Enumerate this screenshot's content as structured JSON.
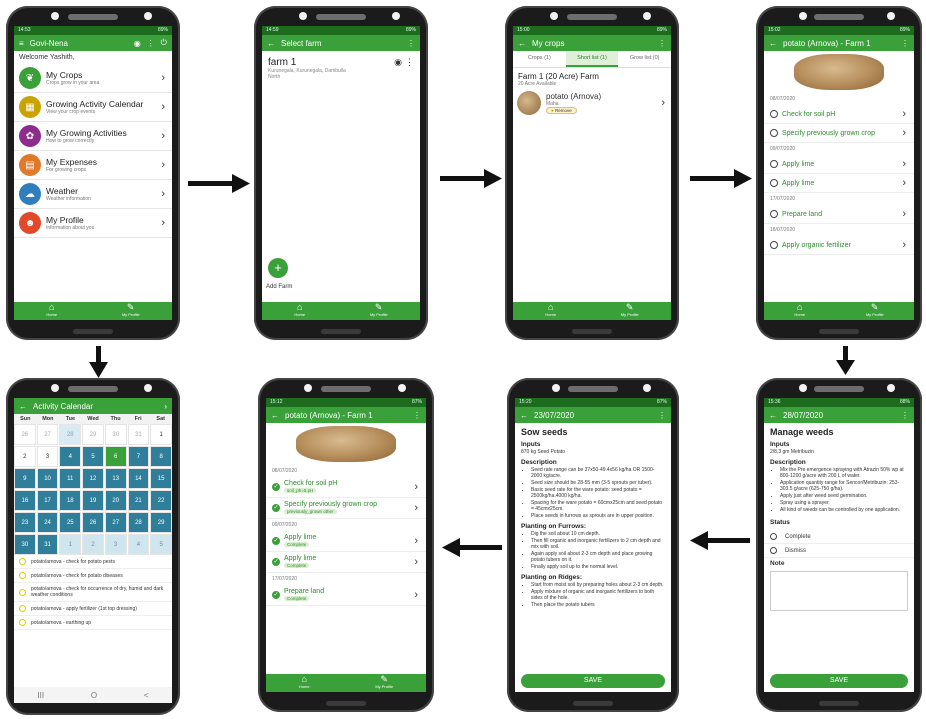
{
  "phone1": {
    "status": {
      "time": "14:53",
      "right": "89%"
    },
    "title": "Govi-Nena",
    "welcome": "Welcome Yashith,",
    "items": [
      {
        "title": "My Crops",
        "sub": "Crops grow in your area",
        "icon": "leaf-icon",
        "color": "#3aa03a",
        "glyph": "❦"
      },
      {
        "title": "Growing Activity Calendar",
        "sub": "View your crop events",
        "icon": "calendar-icon",
        "color": "#c9a300",
        "glyph": "▦"
      },
      {
        "title": "My Growing Activities",
        "sub": "How to grow correctly",
        "icon": "activities-icon",
        "color": "#8e2c8e",
        "glyph": "✿"
      },
      {
        "title": "My Expenses",
        "sub": "For growing crops",
        "icon": "expenses-icon",
        "color": "#e07a2a",
        "glyph": "▤"
      },
      {
        "title": "Weather",
        "sub": "Weather information",
        "icon": "weather-icon",
        "color": "#2f7fbf",
        "glyph": "☁"
      },
      {
        "title": "My Profile",
        "sub": "Information about you",
        "icon": "profile-icon",
        "color": "#e04a2a",
        "glyph": "☻"
      }
    ],
    "nav": [
      "Home",
      "My Profile"
    ]
  },
  "phone2": {
    "status": {
      "time": "14:59",
      "right": "89%"
    },
    "title": "Select farm",
    "farm_name": "farm 1",
    "farm_addr": "Kurunegala, Kurunegala, Dambulla\nNorth",
    "add_label": "Add Farm",
    "nav": [
      "Home",
      "My Profile"
    ]
  },
  "phone3": {
    "status": {
      "time": "15:00",
      "right": "89%"
    },
    "title": "My crops",
    "tabs": [
      "Crops (1)",
      "Short list (1)",
      "Grow list (0)"
    ],
    "farm": "Farm 1 (20 Acre) Farm",
    "avail": "20 Acre Available",
    "crop": "potato (Arnova)",
    "season": "Maha",
    "badge": "Remove",
    "nav": [
      "Home",
      "My Profile"
    ]
  },
  "phone4": {
    "status": {
      "time": "15:02",
      "right": "89%"
    },
    "title": "potato (Arnova) - Farm 1",
    "entries": [
      {
        "date": "08/07/2020",
        "tasks": [
          "Check for soil pH",
          "Specify previously grown crop"
        ]
      },
      {
        "date": "09/07/2020",
        "tasks": [
          "Apply lime",
          "Apply lime"
        ]
      },
      {
        "date": "17/07/2020",
        "tasks": [
          "Prepare land"
        ]
      },
      {
        "date": "18/07/2020",
        "tasks": [
          "Apply organic fertilizer"
        ]
      }
    ],
    "nav": [
      "Home",
      "My Profile"
    ]
  },
  "phone5": {
    "title": "Activity Calendar",
    "days": [
      "Sun",
      "Mon",
      "Tue",
      "Wed",
      "Thu",
      "Fri",
      "Sat"
    ],
    "cells": [
      {
        "v": "26",
        "c": "muted"
      },
      {
        "v": "27",
        "c": "muted"
      },
      {
        "v": "28",
        "c": "today"
      },
      {
        "v": "29",
        "c": "muted"
      },
      {
        "v": "30",
        "c": "muted"
      },
      {
        "v": "31",
        "c": "muted"
      },
      {
        "v": "1",
        "c": ""
      },
      {
        "v": "2",
        "c": ""
      },
      {
        "v": "3",
        "c": ""
      },
      {
        "v": "4",
        "c": "blue"
      },
      {
        "v": "5",
        "c": "blue"
      },
      {
        "v": "6",
        "c": "green"
      },
      {
        "v": "7",
        "c": "blue"
      },
      {
        "v": "8",
        "c": "blue"
      },
      {
        "v": "9",
        "c": "blue"
      },
      {
        "v": "10",
        "c": "blue"
      },
      {
        "v": "11",
        "c": "blue"
      },
      {
        "v": "12",
        "c": "blue"
      },
      {
        "v": "13",
        "c": "blue"
      },
      {
        "v": "14",
        "c": "blue"
      },
      {
        "v": "15",
        "c": "blue"
      },
      {
        "v": "16",
        "c": "blue"
      },
      {
        "v": "17",
        "c": "blue"
      },
      {
        "v": "18",
        "c": "blue"
      },
      {
        "v": "19",
        "c": "blue"
      },
      {
        "v": "20",
        "c": "blue"
      },
      {
        "v": "21",
        "c": "blue"
      },
      {
        "v": "22",
        "c": "blue"
      },
      {
        "v": "23",
        "c": "blue"
      },
      {
        "v": "24",
        "c": "blue"
      },
      {
        "v": "25",
        "c": "blue"
      },
      {
        "v": "26",
        "c": "blue"
      },
      {
        "v": "27",
        "c": "blue"
      },
      {
        "v": "28",
        "c": "blue"
      },
      {
        "v": "29",
        "c": "blue"
      },
      {
        "v": "30",
        "c": "blue"
      },
      {
        "v": "31",
        "c": "blue"
      },
      {
        "v": "1",
        "c": "light"
      },
      {
        "v": "2",
        "c": "light"
      },
      {
        "v": "3",
        "c": "light"
      },
      {
        "v": "4",
        "c": "light"
      },
      {
        "v": "5",
        "c": "light"
      }
    ],
    "events": [
      "potato/arnova - check for potato pests",
      "potato/arnova - check for potato diseases",
      "potato/arnova - check for occurrence of dry, humid and dark weather conditions",
      "potato/arnova - apply fertilizer (1st top dressing)",
      "potato/arnova - earthing up"
    ],
    "sysnav": [
      "III",
      "O",
      "<"
    ]
  },
  "phone6": {
    "status": {
      "time": "15:12",
      "right": "87%"
    },
    "title": "potato (Arnova) - Farm 1",
    "entries": [
      {
        "date": "08/07/2020",
        "tasks": [
          {
            "t": "Check for soil pH",
            "b": "soil_ph=5.pH"
          },
          {
            "t": "Specify previously grown crop",
            "b": "previously_grown other"
          }
        ]
      },
      {
        "date": "09/07/2020",
        "tasks": [
          {
            "t": "Apply lime",
            "b": "Complete"
          },
          {
            "t": "Apply lime",
            "b": "Complete"
          }
        ]
      },
      {
        "date": "17/07/2020",
        "tasks": [
          {
            "t": "Prepare land",
            "b": "Complete"
          }
        ]
      }
    ],
    "nav": [
      "Home",
      "My Profile"
    ]
  },
  "phone7": {
    "status": {
      "time": "15:20",
      "right": "87%"
    },
    "date": "23/07/2020",
    "heading": "Sow seeds",
    "inputs_label": "Inputs",
    "inputs": "870 kg Seed Potato",
    "desc_label": "Description",
    "desc": [
      "Seed rate range can be 37x50-49.4x56 kg/ha OR 1500-2000 kg/acre.",
      "Seed size should be 28-55 mm (3-5 sprouts per tuber).",
      "Basic seed rate for the ware potato: seed potato = 2500kg/ha.4000 kg/ha.",
      "Spacing for the ware potato = 60cmx25cm and seed potato = 45cmx25cm.",
      "Place seeds in furrows as sprouts are in upper position."
    ],
    "furrow_label": "Planting on Furrows:",
    "furrow": [
      "Dig the soil about 10 cm depth.",
      "Then fill organic and inorganic fertilizers to 2 cm depth and mix with soil.",
      "Again apply soil about 2-3 cm depth and place growing potato tubers on it.",
      "Finally apply soil up to the normal level."
    ],
    "ridge_label": "Planting on Ridges:",
    "ridge": [
      "Start from moist soil by preparing holes about 2-3 cm depth.",
      "Apply mixture of organic and inorganic fertilizers to both sides of the hole.",
      "Then place the potato tubers"
    ],
    "save": "SAVE"
  },
  "phone8": {
    "status": {
      "time": "15:36",
      "right": "88%"
    },
    "date": "28/07/2020",
    "heading": "Manage weeds",
    "inputs_label": "Inputs",
    "inputs": "2/8.3 gm Metribuzin",
    "desc_label": "Description",
    "desc": [
      "Mix the Pre emergence spraying with Atrazin 50% wp at 800-1200 g/acre with 200 L of water.",
      "Application quantity range for Sencor/Metribuzin: 253-303.5 g/acre (625-750 g/ha).",
      "Apply just after weed seed germination.",
      "Spray using a sprayer.",
      "All kind of weeds can be controlled by one application."
    ],
    "status_label": "Status",
    "opts": [
      "Complete",
      "Dismiss"
    ],
    "note_label": "Note",
    "save": "SAVE"
  }
}
